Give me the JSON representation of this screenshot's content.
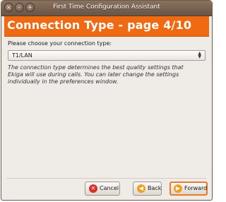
{
  "window": {
    "title": "First Time Configuration Assistant"
  },
  "banner": {
    "heading": "Connection Type - page 4/10"
  },
  "content": {
    "prompt": "Please choose your connection type:",
    "combo_value": "T1/LAN",
    "description": "The connection type determines the best quality settings that Ekiga will use during calls. You can later change the settings individually in the preferences window."
  },
  "buttons": {
    "cancel": "Cancel",
    "back": "Back",
    "forward": "Forward"
  },
  "colors": {
    "banner": "#f06a14",
    "titlebar": "#6b5444",
    "window_bg": "#efebe7"
  }
}
